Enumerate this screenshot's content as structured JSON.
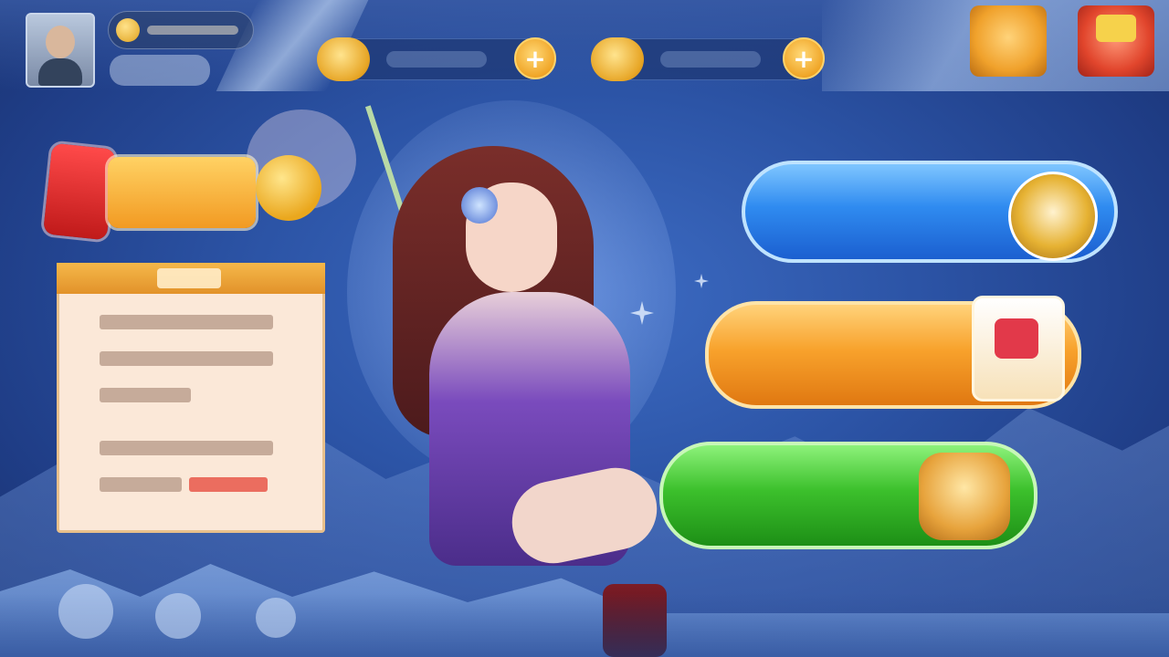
{
  "top_bar": {
    "currency_1": {
      "plus_label": "+"
    },
    "currency_2": {
      "plus_label": "+"
    }
  },
  "mode_buttons": {
    "blue_label": "",
    "orange_label": "",
    "green_label": ""
  },
  "colors": {
    "blue_button": "#2f8bf0",
    "orange_button": "#f8a22c",
    "green_button": "#3cc02c",
    "notice_background": "#fbe8d8",
    "notice_header": "#e2922a"
  },
  "icons": {
    "avatar": "avatar",
    "gold_coin": "coin-icon",
    "gem": "gem-icon",
    "mall": "shop-icon",
    "activity": "gift-icon"
  }
}
